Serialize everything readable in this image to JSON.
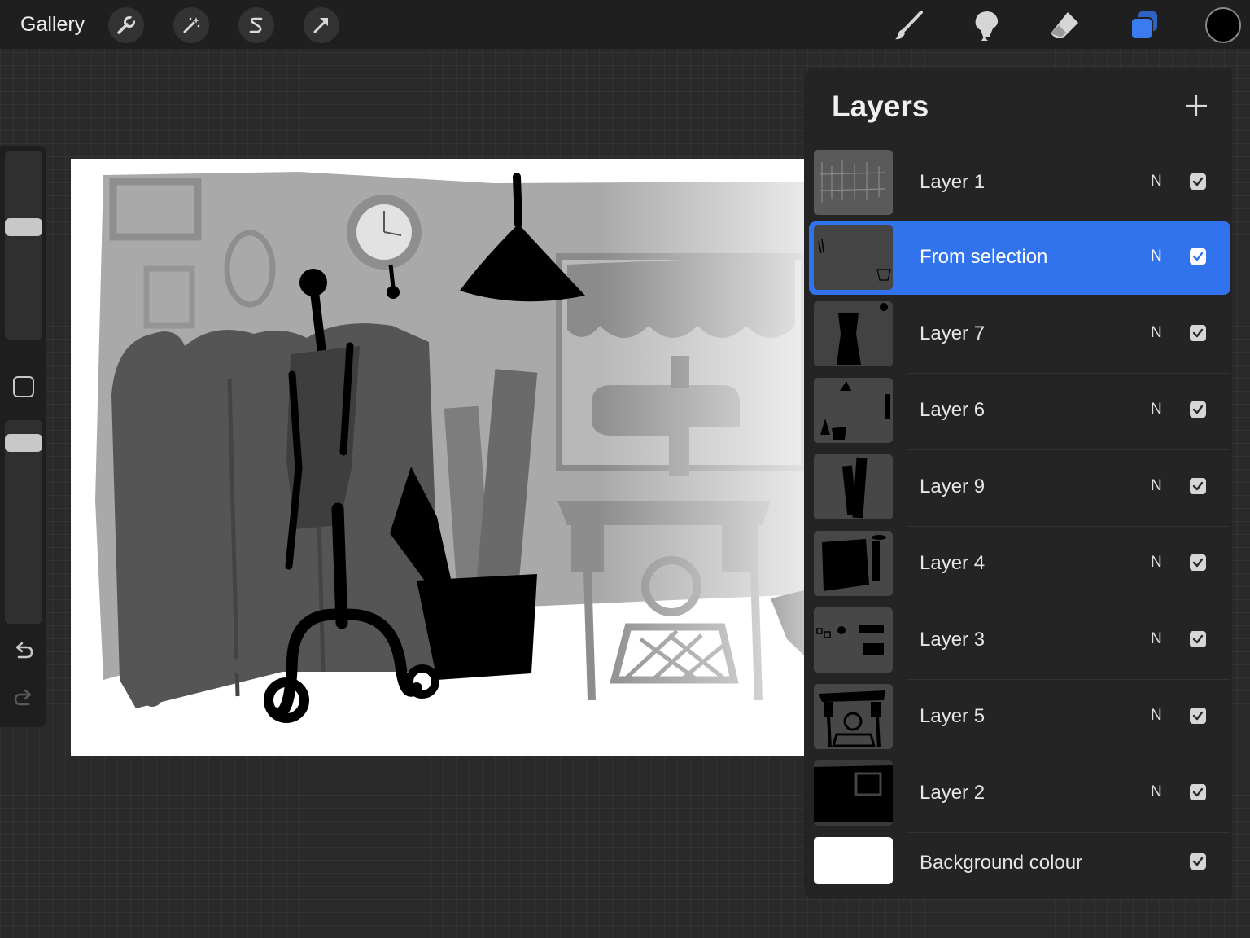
{
  "toolbar": {
    "gallery_label": "Gallery",
    "left_tools": [
      "wrench-icon",
      "magic-wand-icon",
      "selection-s-icon",
      "transform-arrow-icon"
    ],
    "right_tools": [
      "brush-icon",
      "smudge-icon",
      "eraser-icon",
      "layers-icon"
    ],
    "active_tool": "layers-icon",
    "current_color": "#000000",
    "accent_color": "#3173ec"
  },
  "sidebar": {
    "tools": [
      "brush-size-slider",
      "modify-button",
      "opacity-slider",
      "undo-icon",
      "redo-icon"
    ]
  },
  "layers_panel": {
    "title": "Layers",
    "add_icon": "plus-icon",
    "layers": [
      {
        "name": "Layer 1",
        "blend": "N",
        "visible": true,
        "selected": false
      },
      {
        "name": "From selection",
        "blend": "N",
        "visible": true,
        "selected": true
      },
      {
        "name": "Layer 7",
        "blend": "N",
        "visible": true,
        "selected": false
      },
      {
        "name": "Layer 6",
        "blend": "N",
        "visible": true,
        "selected": false
      },
      {
        "name": "Layer 9",
        "blend": "N",
        "visible": true,
        "selected": false
      },
      {
        "name": "Layer 4",
        "blend": "N",
        "visible": true,
        "selected": false
      },
      {
        "name": "Layer 3",
        "blend": "N",
        "visible": true,
        "selected": false
      },
      {
        "name": "Layer 5",
        "blend": "N",
        "visible": true,
        "selected": false
      },
      {
        "name": "Layer 2",
        "blend": "N",
        "visible": true,
        "selected": false
      }
    ],
    "background": {
      "name": "Background colour",
      "visible": true,
      "color": "#ffffff"
    }
  }
}
